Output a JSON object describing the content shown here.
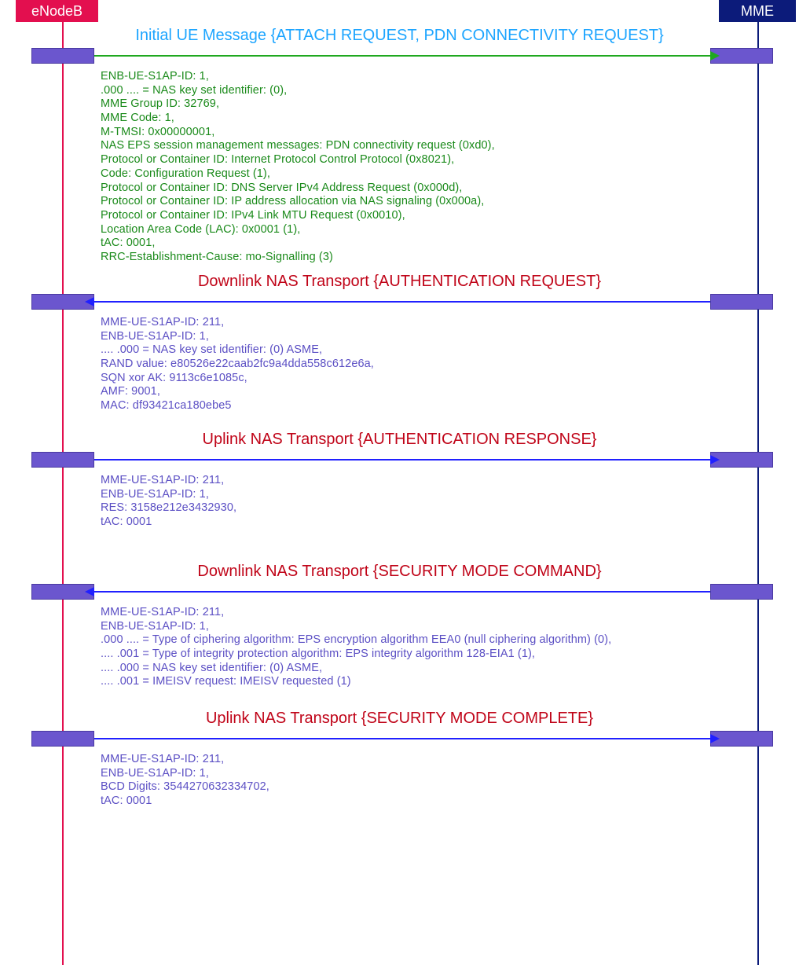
{
  "participants": {
    "left": "eNodeB",
    "right": "MME"
  },
  "msg1": {
    "title": "Initial UE Message {ATTACH REQUEST, PDN CONNECTIVITY REQUEST}",
    "details": "ENB-UE-S1AP-ID: 1,\n.000 .... = NAS key set identifier: (0),\nMME Group ID: 32769,\nMME Code: 1,\nM-TMSI: 0x00000001,\nNAS EPS session management messages: PDN connectivity request (0xd0),\nProtocol or Container ID: Internet Protocol Control Protocol (0x8021),\nCode: Configuration Request (1),\nProtocol or Container ID: DNS Server IPv4 Address Request (0x000d),\nProtocol or Container ID: IP address allocation via NAS signaling (0x000a),\nProtocol or Container ID: IPv4 Link MTU Request (0x0010),\nLocation Area Code (LAC): 0x0001 (1),\ntAC: 0001,\nRRC-Establishment-Cause: mo-Signalling (3)"
  },
  "msg2": {
    "title": "Downlink NAS Transport {AUTHENTICATION REQUEST}",
    "details": "MME-UE-S1AP-ID: 211,\nENB-UE-S1AP-ID: 1,\n.... .000 = NAS key set identifier: (0) ASME,\nRAND value: e80526e22caab2fc9a4dda558c612e6a,\nSQN xor AK: 9113c6e1085c,\nAMF: 9001,\nMAC: df93421ca180ebe5"
  },
  "msg3": {
    "title": "Uplink NAS Transport {AUTHENTICATION RESPONSE}",
    "details": "MME-UE-S1AP-ID: 211,\nENB-UE-S1AP-ID: 1,\nRES: 3158e212e3432930,\ntAC: 0001"
  },
  "msg4": {
    "title": "Downlink NAS Transport {SECURITY MODE COMMAND}",
    "details": "MME-UE-S1AP-ID: 211,\nENB-UE-S1AP-ID: 1,\n.000 .... = Type of ciphering algorithm: EPS encryption algorithm EEA0 (null ciphering algorithm) (0),\n.... .001 = Type of integrity protection algorithm: EPS integrity algorithm 128-EIA1 (1),\n.... .000 = NAS key set identifier: (0) ASME,\n.... .001 = IMEISV request: IMEISV requested (1)"
  },
  "msg5": {
    "title": "Uplink NAS Transport {SECURITY MODE COMPLETE}",
    "details": "MME-UE-S1AP-ID: 211,\nENB-UE-S1AP-ID: 1,\nBCD Digits: 3544270632334702,\ntAC: 0001"
  }
}
